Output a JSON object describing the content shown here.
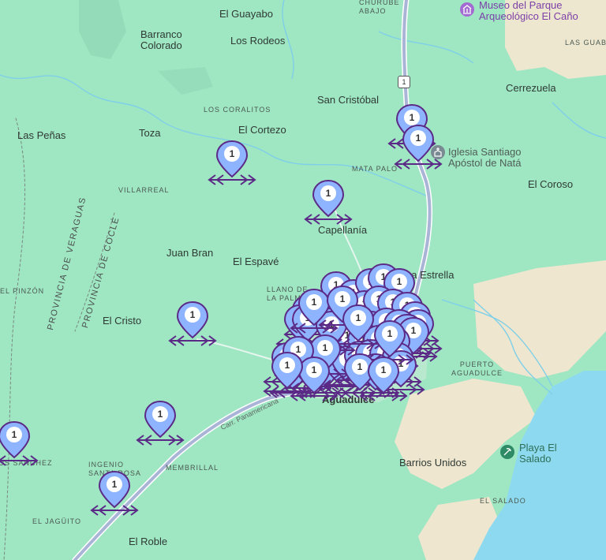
{
  "map": {
    "colors": {
      "land": "#9fe6c3",
      "sea": "#8fd9ee",
      "beige": "#f0e8d2",
      "road": "#9aa8c8",
      "marker": "#8fb4ff",
      "marker_stroke": "#5b2a86"
    },
    "labels": {
      "el_guayabo": "El Guayabo",
      "barranco_colorado": "Barranco\nColorado",
      "los_rodeos": "Los Rodeos",
      "churube_abajo": "CHURUBE\nABAJO",
      "museo": "Museo del Parque\nArqueológico El Caño",
      "las_guabas": "LAS GUABA",
      "cerrezuela": "Cerrezuela",
      "los_coralitos": "LOS CORALITOS",
      "san_cristobal": "San Cristóbal",
      "las_penas": "Las Peñas",
      "toza": "Toza",
      "el_cortezo": "El Cortezo",
      "iglesia": "Iglesia Santiago\nApóstol de Natá",
      "mata_palo": "MATA PALO",
      "el_coroso": "El Coroso",
      "villarreal": "VILLARREAL",
      "capellania": "Capellanía",
      "provincia_veraguas": "PROVINCIA DE VERAGUAS",
      "provincia_cocle": "PROVINCIA DE COCLÉ",
      "juan_bran": "Juan Bran",
      "el_espave": "El Espavé",
      "la_estrella": "La Estrella",
      "el_pinzon": "EL PINZÓN",
      "llano_de_la_palma": "LLANO DE\nLA PALMA",
      "el_cristo": "El Cristo",
      "puerto_aguadulce": "PUERTO\nAGUADULCE",
      "aguadulce": "Aguadulce",
      "carr_panamericana": "Carr. Panamericana",
      "ingenio_santa_rosa": "INGENIO\nSANTA ROSA",
      "membrillal": "MEMBRILLAL",
      "barrios_unidos": "Barrios Unidos",
      "playa_el_salado": "Playa El\nSalado",
      "los_sanchez": "LOS SANCHEZ",
      "el_jaguito": "EL JAGÜITO",
      "el_salado": "EL SALADO",
      "el_roble": "El Roble",
      "route_1": "1"
    },
    "marker_count_label": "1",
    "markers": 58
  }
}
